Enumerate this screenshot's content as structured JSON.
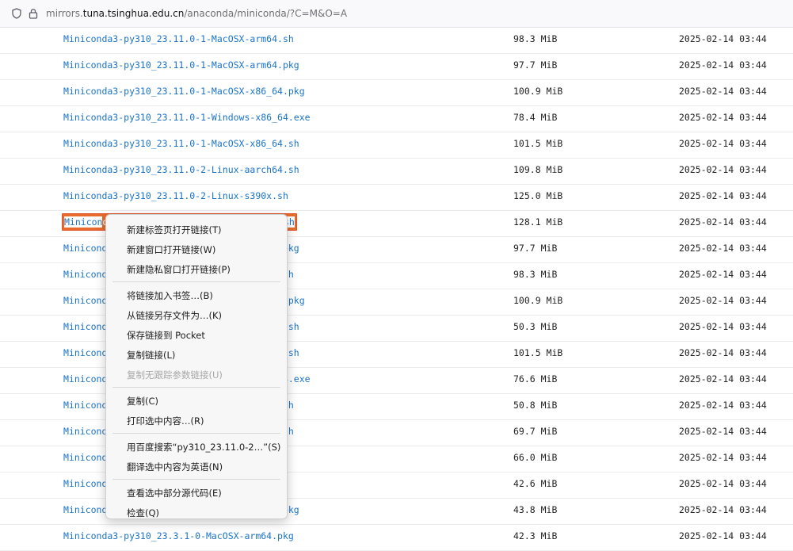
{
  "browser": {
    "url_prefix": "mirrors.",
    "url_host": "tuna.tsinghua.edu.cn",
    "url_path": "/anaconda/miniconda/?C=M&O=A"
  },
  "files": [
    {
      "name": "Miniconda3-py310_23.11.0-1-MacOSX-arm64.sh",
      "size": "98.3 MiB",
      "date": "2025-02-14 03:44"
    },
    {
      "name": "Miniconda3-py310_23.11.0-1-MacOSX-arm64.pkg",
      "size": "97.7 MiB",
      "date": "2025-02-14 03:44"
    },
    {
      "name": "Miniconda3-py310_23.11.0-1-MacOSX-x86_64.pkg",
      "size": "100.9 MiB",
      "date": "2025-02-14 03:44"
    },
    {
      "name": "Miniconda3-py310_23.11.0-1-Windows-x86_64.exe",
      "size": "78.4 MiB",
      "date": "2025-02-14 03:44"
    },
    {
      "name": "Miniconda3-py310_23.11.0-1-MacOSX-x86_64.sh",
      "size": "101.5 MiB",
      "date": "2025-02-14 03:44"
    },
    {
      "name": "Miniconda3-py310_23.11.0-2-Linux-aarch64.sh",
      "size": "109.8 MiB",
      "date": "2025-02-14 03:44"
    },
    {
      "name": "Miniconda3-py310_23.11.0-2-Linux-s390x.sh",
      "size": "125.0 MiB",
      "date": "2025-02-14 03:44"
    },
    {
      "name_start": "Minicon",
      "name_mid": "da3-py310_23.11.0-2-Linux-x86_",
      "name_end": "64.sh",
      "size": "128.1 MiB",
      "date": "2025-02-14 03:44",
      "selected": true
    },
    {
      "name": "Miniconda3-py310_23.11.0-2-MacOSX-arm64.pkg",
      "size": "97.7 MiB",
      "date": "2025-02-14 03:44"
    },
    {
      "name": "Miniconda3-py310_23.11.0-2-MacOSX-arm64.sh",
      "size": "98.3 MiB",
      "date": "2025-02-14 03:44"
    },
    {
      "name": "Miniconda3-py310_23.11.0-2-MacOSX-x86_64.pkg",
      "size": "100.9 MiB",
      "date": "2025-02-14 03:44"
    },
    {
      "name": "Miniconda3-py310_23.11.0-2-Linux-ppc64le.sh",
      "size": "50.3 MiB",
      "date": "2025-02-14 03:44"
    },
    {
      "name": "Miniconda3-py310_23.11.0-2-MacOSX-x86_64.sh",
      "size": "101.5 MiB",
      "date": "2025-02-14 03:44"
    },
    {
      "name": "Miniconda3-py310_23.11.0-2-Windows-x86_64.exe",
      "size": "76.6 MiB",
      "date": "2025-02-14 03:44"
    },
    {
      "name": "Miniconda3-py310_23.3.1-0-Linux-ppc64le.sh",
      "size": "50.8 MiB",
      "date": "2025-02-14 03:44"
    },
    {
      "name": "Miniconda3-py310_23.3.1-0-Linux-aarch64.sh",
      "size": "69.7 MiB",
      "date": "2025-02-14 03:44"
    },
    {
      "name": "Miniconda3-py310_23.3.1-0-Linux-s390x.sh",
      "size": "66.0 MiB",
      "date": "2025-02-14 03:44"
    },
    {
      "name": "Miniconda3-py310_23.3.1-0-MacOSX-arm64.sh",
      "size": "42.6 MiB",
      "date": "2025-02-14 03:44"
    },
    {
      "name": "Miniconda3-py310_23.3.1-0-MacOSX-x86_64.pkg",
      "size": "43.8 MiB",
      "date": "2025-02-14 03:44"
    },
    {
      "name": "Miniconda3-py310_23.3.1-0-MacOSX-arm64.pkg",
      "size": "42.3 MiB",
      "date": "2025-02-14 03:44"
    }
  ],
  "visible_name_tails": [
    "",
    "",
    "",
    "",
    "",
    "",
    "",
    "",
    "64.pkg",
    "64.sh",
    "_64.pkg",
    "64.sh",
    "_64.sh",
    "86_64.exe",
    "le.sh",
    "4.sh",
    ".sh",
    "4.sh",
    "64.pkg",
    ""
  ],
  "context_menu": {
    "items": [
      {
        "label": "新建标签页打开链接(T)"
      },
      {
        "label": "新建窗口打开链接(W)"
      },
      {
        "label": "新建隐私窗口打开链接(P)"
      },
      {
        "separator": true
      },
      {
        "label": "将链接加入书签…(B)"
      },
      {
        "label": "从链接另存文件为…(K)"
      },
      {
        "label": "保存链接到 Pocket"
      },
      {
        "label": "复制链接(L)"
      },
      {
        "label": "复制无跟踪参数链接(U)",
        "disabled": true
      },
      {
        "separator": true
      },
      {
        "label": "复制(C)"
      },
      {
        "label": "打印选中内容…(R)"
      },
      {
        "separator": true
      },
      {
        "label": "用百度搜索“py310_23.11.0-2…”(S)"
      },
      {
        "label": "翻译选中内容为英语(N)"
      },
      {
        "separator": true
      },
      {
        "label": "查看选中部分源代码(E)"
      },
      {
        "label": "检查(Q)"
      }
    ]
  },
  "colors": {
    "link": "#1a73c8",
    "selection": "#e86a2c"
  }
}
